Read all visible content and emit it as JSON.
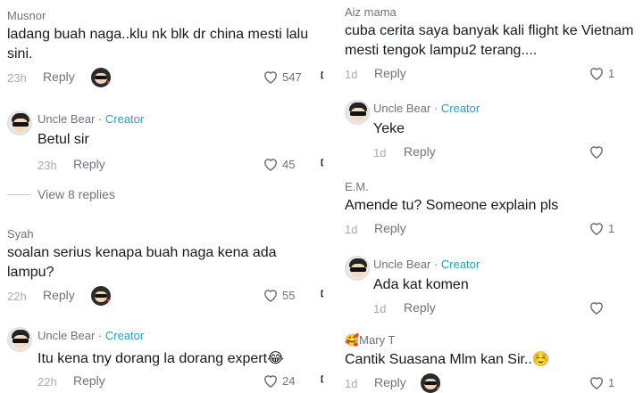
{
  "left": {
    "c1": {
      "user": "Musnor",
      "text": "ladang buah naga..klu nk blk dr china mesti lalu sini.",
      "time": "23h",
      "reply": "Reply",
      "likes": "547"
    },
    "r1": {
      "user": "Uncle Bear",
      "sep": " · ",
      "badge": "Creator",
      "text": "Betul sir",
      "time": "23h",
      "reply": "Reply",
      "likes": "45"
    },
    "view_replies": "View 8 replies",
    "c2": {
      "user": "Syah",
      "text": "soalan serius kenapa buah naga kena ada lampu?",
      "time": "22h",
      "reply": "Reply",
      "likes": "55"
    },
    "r2": {
      "user": "Uncle Bear",
      "sep": " · ",
      "badge": "Creator",
      "text": "Itu kena tny dorang la dorang expert😂",
      "time": "22h",
      "reply": "Reply",
      "likes": "24"
    }
  },
  "right": {
    "c1": {
      "user": "Aiz mama",
      "text": "cuba cerita saya banyak kali flight ke Vietnam mesti tengok lampu2 terang....",
      "time": "1d",
      "reply": "Reply",
      "likes": "1"
    },
    "r1": {
      "user": "Uncle Bear",
      "sep": " · ",
      "badge": "Creator",
      "text": "Yeke",
      "time": "1d",
      "reply": "Reply"
    },
    "c2": {
      "user": "E.M.",
      "text": "Amende tu? Someone explain pls",
      "time": "1d",
      "reply": "Reply",
      "likes": "1"
    },
    "r2": {
      "user": "Uncle Bear",
      "sep": " · ",
      "badge": "Creator",
      "text": "Ada kat komen",
      "time": "1d",
      "reply": "Reply"
    },
    "c3": {
      "user": "🥰Mary T",
      "text": "Cantik Suasana Mlm kan Sir..☺️",
      "time": "1d",
      "reply": "Reply",
      "likes": "1"
    }
  },
  "icons": {
    "like": "heart-outline-icon",
    "dislike": "thumbs-down-icon",
    "creator_liked": "creator-liked-avatar-icon"
  },
  "colors": {
    "creator": "#20a3b8",
    "text": "#161823",
    "muted": "#6f7380",
    "heart": "#fe2c55"
  }
}
